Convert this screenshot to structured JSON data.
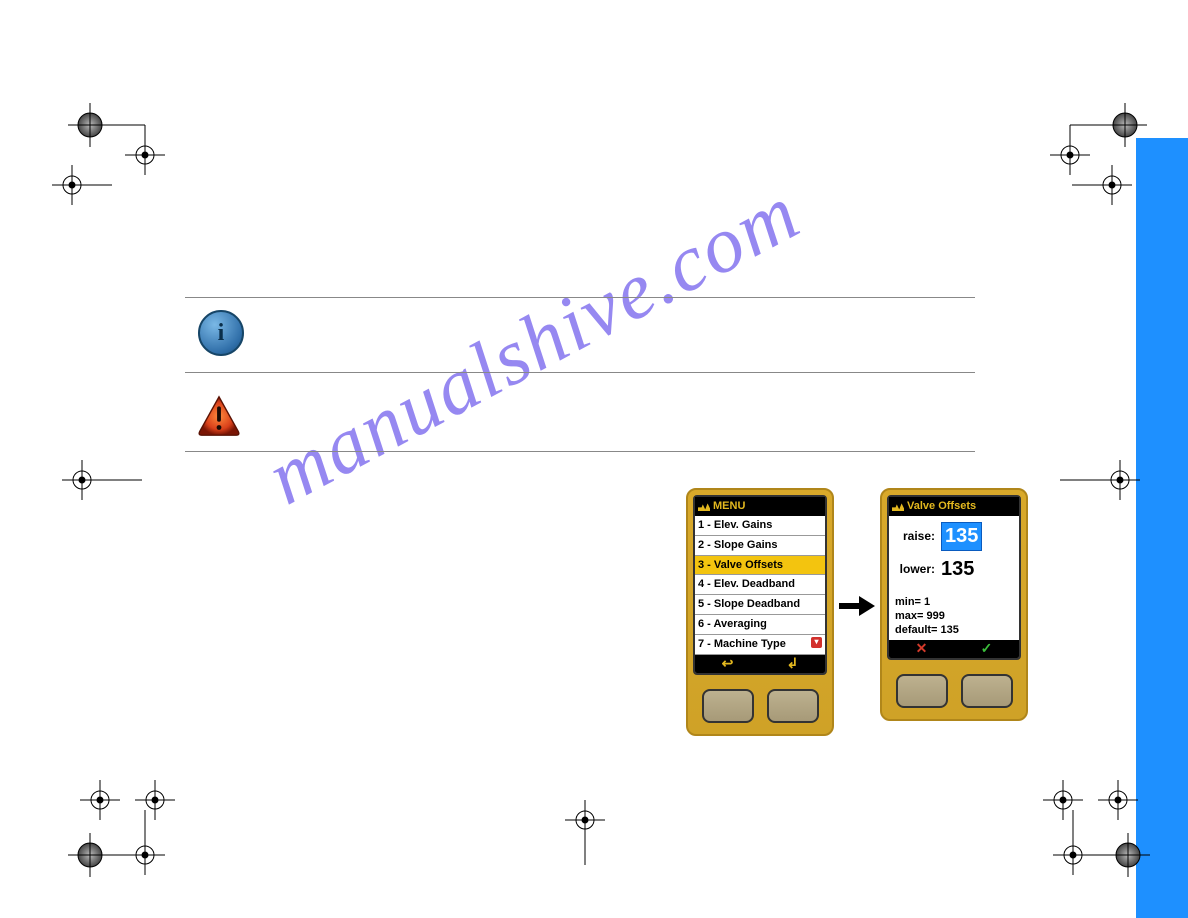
{
  "watermark": "manualshive.com",
  "menu": {
    "title": "MENU",
    "items": [
      "1 - Elev. Gains",
      "2 - Slope Gains",
      "3 - Valve Offsets",
      "4 - Elev. Deadband",
      "5 - Slope Deadband",
      "6 - Averaging",
      "7 - Machine Type"
    ],
    "selected_index": 2,
    "soft_left": "↩",
    "soft_right": "↲"
  },
  "valve_offsets": {
    "title": "Valve Offsets",
    "raise_label": "raise:",
    "raise_value": "135",
    "lower_label": "lower:",
    "lower_value": "135",
    "min": "min= 1",
    "max": "max= 999",
    "default": "default= 135",
    "soft_left": "✕",
    "soft_right": "✓"
  }
}
